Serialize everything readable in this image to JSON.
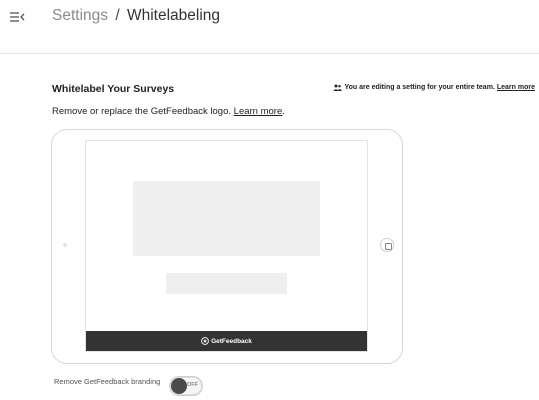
{
  "header": {
    "breadcrumb_parent": "Settings",
    "breadcrumb_separator": "/",
    "breadcrumb_current": "Whitelabeling",
    "menu_icon": "menu-collapse-icon"
  },
  "section": {
    "title": "Whitelabel Your Surveys",
    "team_note": "You are editing a setting for your entire team.",
    "team_note_link": "Learn more",
    "team_icon": "users-icon",
    "description": "Remove or replace the GetFeedback logo.",
    "description_link": "Learn more",
    "description_end": "."
  },
  "preview": {
    "brand_label": "GetFeedback",
    "brand_icon": "getfeedback-logo-icon",
    "brand_bar_color": "#333333"
  },
  "branding_toggle": {
    "label": "Remove GetFeedback branding",
    "state_label": "OFF",
    "enabled": false
  }
}
